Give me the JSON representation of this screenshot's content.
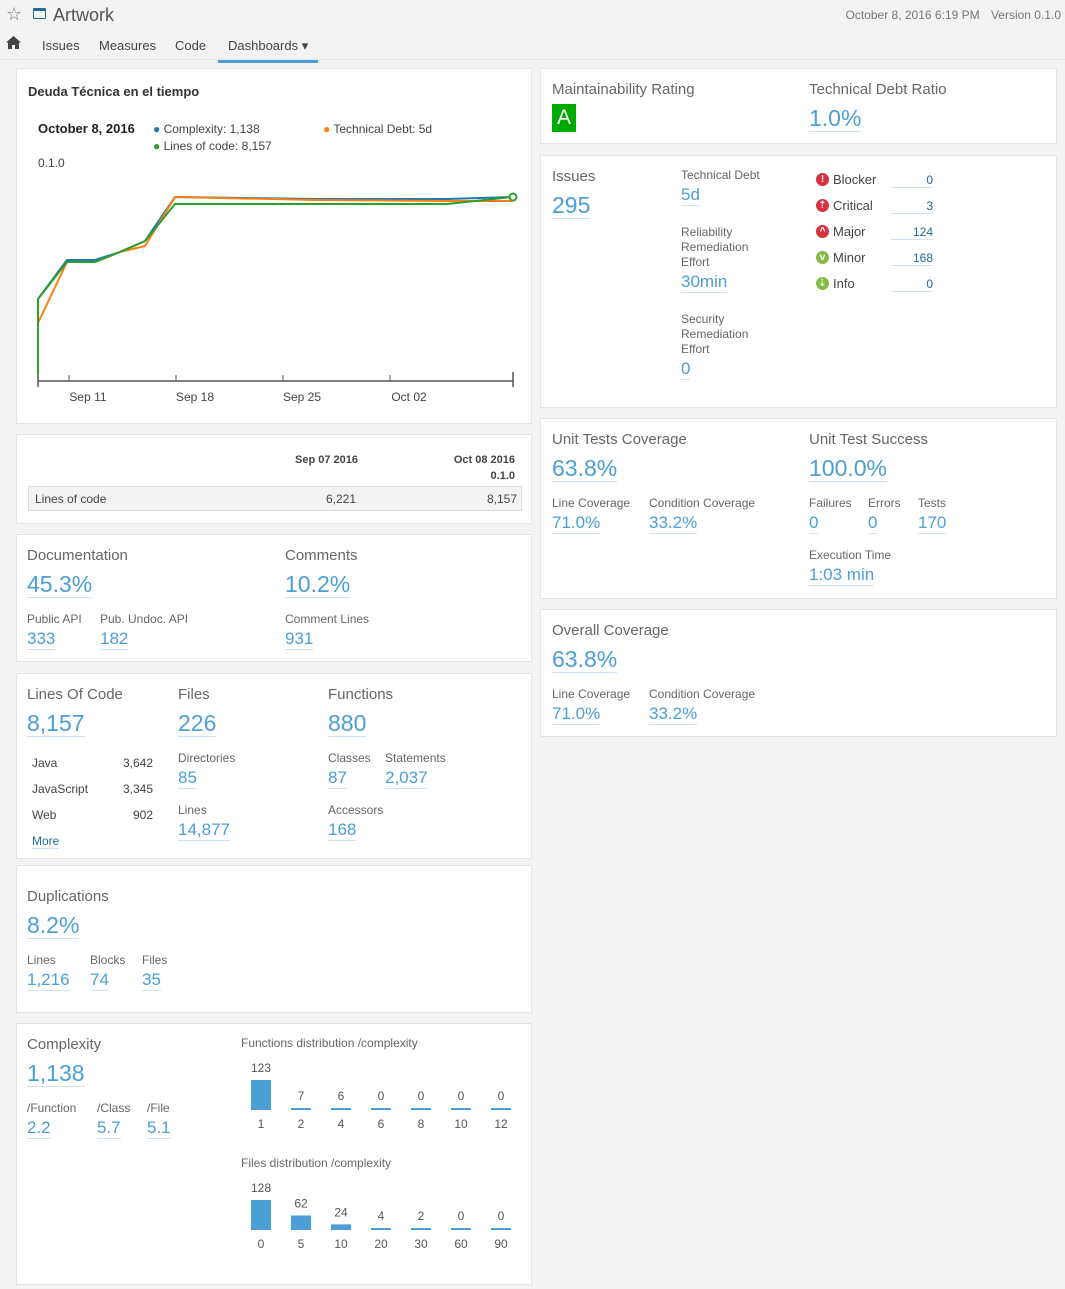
{
  "header": {
    "project_name": "Artwork",
    "date": "October 8, 2016 6:19 PM",
    "version": "Version 0.1.0",
    "star_icon": "star-icon",
    "qualifier_icon": "project-icon"
  },
  "nav": {
    "home_icon": "home-icon",
    "items": [
      "Issues",
      "Measures",
      "Code"
    ],
    "dashboards": "Dashboards ▾"
  },
  "timeline": {
    "title": "Deuda Técnica en el tiempo",
    "tooltip_date": "October 8, 2016",
    "event_label": "0.1.0",
    "legend": [
      "Complexity: 1,138",
      "Technical Debt: 5d",
      "Lines of code: 8,157"
    ]
  },
  "chart_data": {
    "type": "line",
    "x_ticks": [
      "Sep 11",
      "Sep 18",
      "Sep 25",
      "Oct 02"
    ],
    "series": [
      {
        "name": "Complexity",
        "color": "#1f77b4",
        "points": [
          [
            0,
            0
          ],
          [
            0.05,
            0.42
          ],
          [
            0.4,
            0.95
          ],
          [
            1.0,
            0.97
          ]
        ]
      },
      {
        "name": "Technical Debt",
        "color": "#ff7f0e",
        "points": [
          [
            0,
            0
          ],
          [
            0.05,
            0.3
          ],
          [
            0.4,
            0.95
          ],
          [
            1.0,
            0.95
          ]
        ]
      },
      {
        "name": "Lines of code",
        "color": "#2ca02c",
        "points": [
          [
            0,
            0
          ],
          [
            0.05,
            0.42
          ],
          [
            0.4,
            0.93
          ],
          [
            1.0,
            0.97
          ]
        ]
      }
    ],
    "_comment_points": "normalized relative values, chart has no y-axis labels"
  },
  "compare": {
    "col1": "Sep 07 2016",
    "col2": "Oct 08 2016",
    "col2_sub": "0.1.0",
    "row_label": "Lines of code",
    "v1": "6,221",
    "v2": "8,157"
  },
  "documentation": {
    "doc_label": "Documentation",
    "doc_value": "45.3%",
    "comments_label": "Comments",
    "comments_value": "10.2%",
    "public_api_label": "Public API",
    "public_api_value": "333",
    "undoc_label": "Pub. Undoc. API",
    "undoc_value": "182",
    "comment_lines_label": "Comment Lines",
    "comment_lines_value": "931"
  },
  "size": {
    "loc_label": "Lines Of Code",
    "loc_value": "8,157",
    "languages": [
      {
        "name": "Java",
        "value": "3,642"
      },
      {
        "name": "JavaScript",
        "value": "3,345"
      },
      {
        "name": "Web",
        "value": "902"
      }
    ],
    "more": "More",
    "files_label": "Files",
    "files_value": "226",
    "dirs_label": "Directories",
    "dirs_value": "85",
    "lines_label": "Lines",
    "lines_value": "14,877",
    "functions_label": "Functions",
    "functions_value": "880",
    "classes_label": "Classes",
    "classes_value": "87",
    "statements_label": "Statements",
    "statements_value": "2,037",
    "accessors_label": "Accessors",
    "accessors_value": "168"
  },
  "duplications": {
    "label": "Duplications",
    "value": "8.2%",
    "lines_label": "Lines",
    "lines_value": "1,216",
    "blocks_label": "Blocks",
    "blocks_value": "74",
    "files_label": "Files",
    "files_value": "35"
  },
  "complexity": {
    "label": "Complexity",
    "value": "1,138",
    "per_function_label": "/Function",
    "per_function_value": "2.2",
    "per_class_label": "/Class",
    "per_class_value": "5.7",
    "per_file_label": "/File",
    "per_file_value": "5.1",
    "func_dist_title": "Functions distribution /complexity",
    "func_dist": [
      {
        "cat": "1",
        "val": "123"
      },
      {
        "cat": "2",
        "val": "7"
      },
      {
        "cat": "4",
        "val": "6"
      },
      {
        "cat": "6",
        "val": "0"
      },
      {
        "cat": "8",
        "val": "0"
      },
      {
        "cat": "10",
        "val": "0"
      },
      {
        "cat": "12",
        "val": "0"
      }
    ],
    "file_dist_title": "Files distribution /complexity",
    "file_dist": [
      {
        "cat": "0",
        "val": "128"
      },
      {
        "cat": "5",
        "val": "62"
      },
      {
        "cat": "10",
        "val": "24"
      },
      {
        "cat": "20",
        "val": "4"
      },
      {
        "cat": "30",
        "val": "2"
      },
      {
        "cat": "60",
        "val": "0"
      },
      {
        "cat": "90",
        "val": "0"
      }
    ]
  },
  "maintainability": {
    "rating_label": "Maintainability Rating",
    "rating_value": "A",
    "rating_color": "#00aa00",
    "ratio_label": "Technical Debt Ratio",
    "ratio_value": "1.0%"
  },
  "issues": {
    "label": "Issues",
    "value": "295",
    "debt_label": "Technical Debt",
    "debt_value": "5d",
    "reliability_label_1": "Reliability",
    "reliability_label_2": "Remediation",
    "reliability_label_3": "Effort",
    "reliability_value": "30min",
    "security_label_1": "Security",
    "security_label_2": "Remediation",
    "security_label_3": "Effort",
    "security_value": "0",
    "severities": [
      {
        "name": "Blocker",
        "value": "0",
        "icon": "blocker-icon",
        "color": "#d4333f"
      },
      {
        "name": "Critical",
        "value": "3",
        "icon": "critical-icon",
        "color": "#d4333f"
      },
      {
        "name": "Major",
        "value": "124",
        "icon": "major-icon",
        "color": "#d4333f"
      },
      {
        "name": "Minor",
        "value": "168",
        "icon": "minor-icon",
        "color": "#85bb43"
      },
      {
        "name": "Info",
        "value": "0",
        "icon": "info-icon",
        "color": "#85bb43"
      }
    ]
  },
  "tests": {
    "coverage_label": "Unit Tests Coverage",
    "coverage_value": "63.8%",
    "line_cov_label": "Line Coverage",
    "line_cov_value": "71.0%",
    "cond_cov_label": "Condition Coverage",
    "cond_cov_value": "33.2%",
    "success_label": "Unit Test Success",
    "success_value": "100.0%",
    "failures_label": "Failures",
    "failures_value": "0",
    "errors_label": "Errors",
    "errors_value": "0",
    "tests_label": "Tests",
    "tests_value": "170",
    "exec_label": "Execution Time",
    "exec_value": "1:03 min"
  },
  "overall": {
    "label": "Overall Coverage",
    "value": "63.8%",
    "line_cov_label": "Line Coverage",
    "line_cov_value": "71.0%",
    "cond_cov_label": "Condition Coverage",
    "cond_cov_value": "33.2%"
  }
}
